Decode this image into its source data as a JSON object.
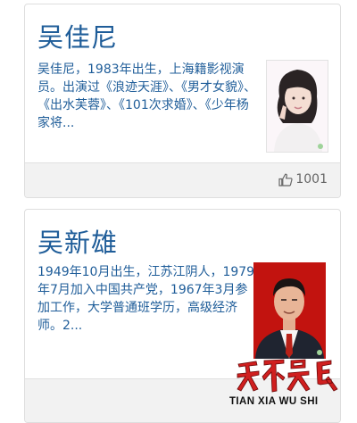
{
  "cards": [
    {
      "name": "吴佳尼",
      "description": "吴佳尼，1983年出生，上海籍影视演员。出演过《浪迹天涯》、《男才女貌》、《出水芙蓉》、《101次求婚》、《少年杨家将...",
      "likes": "1001"
    },
    {
      "name": "吴新雄",
      "description": "1949年10月出生，江苏江阴人，1979年7月加入中国共产党，1967年3月参加工作，大学普通班学历，高级经济师。2...",
      "likes": ""
    }
  ],
  "watermark": {
    "chars": "天下吴氏",
    "roman": "TIAN XIA WU SHI"
  },
  "colors": {
    "title": "#1f5d99",
    "footer": "#f2f2f2",
    "watermark_red": "#c81e1e"
  },
  "icons": {
    "like": "thumbs-up-icon"
  }
}
